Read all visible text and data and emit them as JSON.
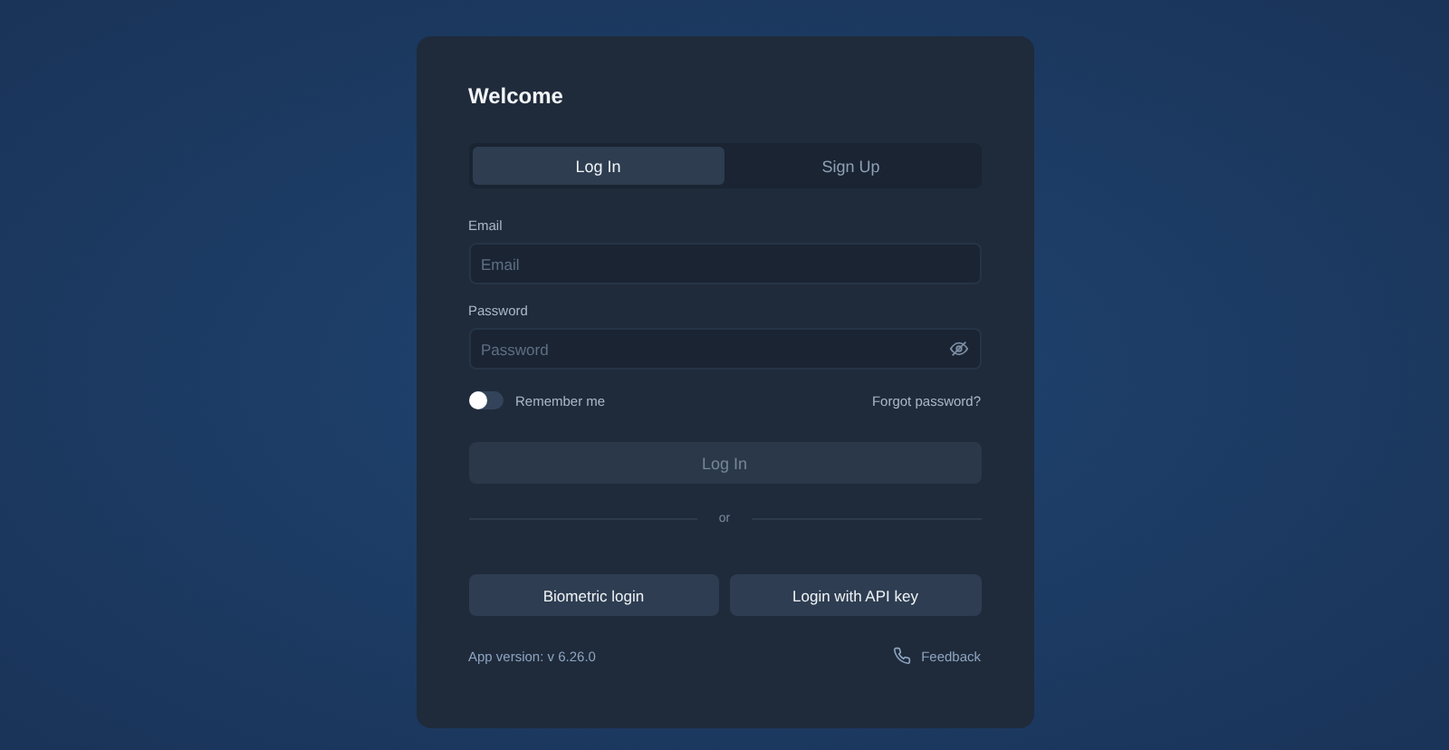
{
  "title": "Welcome",
  "tabs": [
    {
      "label": "Log In",
      "selected": true
    },
    {
      "label": "Sign Up",
      "selected": false
    }
  ],
  "fields": [
    {
      "label": "Email",
      "placeholder": "Email",
      "kind": "text"
    },
    {
      "label": "Password",
      "placeholder": "Password",
      "kind": "password"
    }
  ],
  "remember": {
    "label": "Remember me",
    "on": false
  },
  "forgot_link": "Forgot password?",
  "submit": {
    "label": "Log In",
    "disabled": true
  },
  "divider": "or",
  "alt_buttons": [
    "Biometric login",
    "Login with API key"
  ],
  "version": "App version: v 6.26.0",
  "feedback": "Feedback"
}
